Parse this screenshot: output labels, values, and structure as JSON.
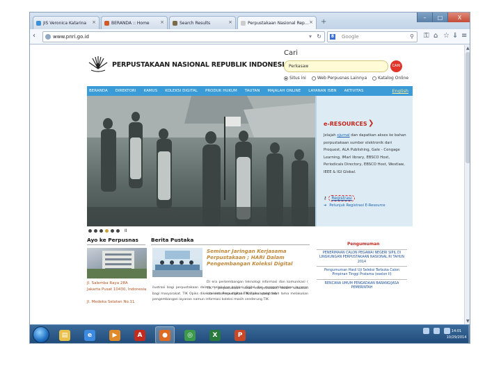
{
  "browser": {
    "tabs": [
      {
        "label": "JIS Veronica Katarina",
        "icon_color": "#3b8fd6",
        "active": false
      },
      {
        "label": "BERANDA :: Home",
        "icon_color": "#d05a2a",
        "active": false
      },
      {
        "label": "Search Results",
        "icon_color": "#7a6a4a",
        "active": false
      },
      {
        "label": "Perpustakaan Nasional Republik...",
        "icon_color": "#cccccc",
        "active": true
      }
    ],
    "new_tab": "+",
    "window_controls": {
      "minimize": "–",
      "maximize": "□",
      "close": "X"
    },
    "url": "www.pnri.go.id",
    "search_engine_placeholder": "Google",
    "toolbar_icons": [
      "key-icon",
      "home-icon",
      "star-icon",
      "download-icon",
      "hamburger-icon"
    ]
  },
  "site": {
    "title": "PERPUSTAKAAN NASIONAL REPUBLIK INDONESIA",
    "search_label": "Cari",
    "search_value": "Perkasaw",
    "search_button": "CARI",
    "search_scopes": [
      "Situs ini",
      "Web Perpusnas Lainnya",
      "Katalog Online"
    ],
    "menu": [
      "BERANDA",
      "DIREKTORI",
      "KAMUS",
      "KOLEKSI DIGITAL",
      "PRODUK HUKUM",
      "TAUTAN",
      "MAJALAH ONLINE",
      "LAYANAN ISBN",
      "AKTIVITAS"
    ],
    "language_link": "English",
    "slideshow_pages": 6,
    "slideshow_active_index": 3,
    "pause_symbol": "II",
    "eresources": {
      "title": "e-RESOURCES",
      "desc_prefix": "Jelajah ",
      "desc_link": "ejurnal",
      "desc_rest": " dan dapatkan akses ke bahan perpustakaan sumber elektronik dari Proquest, ALA Publishing, Gale - Cengage Learning, IMarl library, EBSCO Host, Periodicals Directory, EBSCO Host, Westlaw, IEEE & IGI Global.",
      "register_link": "Registrasi",
      "guide_link": "Petunjuk Registrasi E-Resource"
    },
    "sections": {
      "visit": {
        "heading": "Ayo ke Perpusnas",
        "address1": "Jl. Salemba Raya 28A",
        "address2": "Jakarta Pusat 10430, Indonesia",
        "address3": "Jl. Medeka Selatan No.11"
      },
      "news": {
        "heading": "Berita Pustaka",
        "article_title": "Seminar Jaringan Kerjasama Perpustakaan ; HARI Dalam Pengembangan Koleksi Digital",
        "article_body": "Di era perkembangan teknologi informasi dan komunikasi ( TIK ) perpustakaan harus menyesuaikan dalam kekuatan intelektual era digital. TIK Opiks adalah lab",
        "article_body2": "ilustrasi bagi perpustakaan dalam melakukan koleksi digital dan mengembangkan layanan bagi masyarakat. TIK Opiks dikelola oleh Perpustakaan Nasional yang telah lama melakukan pengembangan layanan namun informasi koleksi masih cenderung TIK."
      },
      "announcements": {
        "heading": "Pengumuman",
        "items": [
          "PENERIMAAN CALON PEGAWAI NEGERI SIPIL DI LINGKUNGAN PERPUSTAKAAN NASIONAL RI TAHUN 2014",
          "Pengumuman Hasil Uji Seleksi Terbuka Calon Pimpinan Tinggi Pratama (eselon II)",
          "RENCANA UMUM PENGADAAN BARANG/JASA PEMERINTAH"
        ]
      }
    }
  },
  "taskbar": {
    "apps": [
      {
        "name": "windows-explorer",
        "color": "#e9c04a",
        "glyph": "▤"
      },
      {
        "name": "internet-explorer",
        "color": "#3d8be0",
        "glyph": "e"
      },
      {
        "name": "media-player",
        "color": "#e08a2a",
        "glyph": "▶"
      },
      {
        "name": "acrobat-reader",
        "color": "#c42b1f",
        "glyph": "A"
      },
      {
        "name": "firefox",
        "color": "#e06a1f",
        "glyph": "●"
      },
      {
        "name": "chrome",
        "color": "#3c9a4a",
        "glyph": "◎"
      },
      {
        "name": "excel",
        "color": "#2a7a3e",
        "glyph": "X"
      },
      {
        "name": "powerpoint",
        "color": "#c8482a",
        "glyph": "P"
      }
    ],
    "clock_time": "14:01",
    "clock_date": "10/29/2014"
  }
}
